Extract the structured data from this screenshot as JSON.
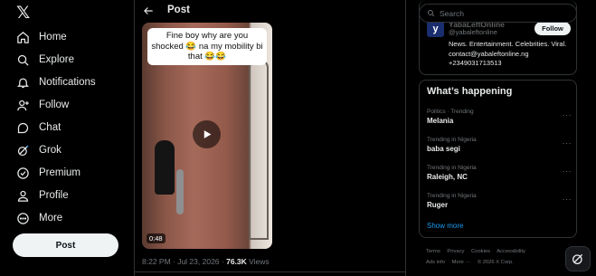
{
  "nav": {
    "logo": "𝕏",
    "items": [
      {
        "label": "Home",
        "icon": "home-icon"
      },
      {
        "label": "Explore",
        "icon": "search-icon"
      },
      {
        "label": "Notifications",
        "icon": "bell-icon"
      },
      {
        "label": "Follow",
        "icon": "add-user-icon"
      },
      {
        "label": "Chat",
        "icon": "chat-icon"
      },
      {
        "label": "Grok",
        "icon": "grok-icon"
      },
      {
        "label": "Premium",
        "icon": "premium-icon"
      },
      {
        "label": "Profile",
        "icon": "profile-icon"
      },
      {
        "label": "More",
        "icon": "more-circle-icon"
      }
    ],
    "post_button": "Post"
  },
  "post": {
    "header_title": "Post",
    "caption": "Fine boy why are you shocked 😂 na my mobility bi that 😂😂",
    "duration": "0:48",
    "time": "8:22 PM · Jul 23, 2026 ·",
    "views_count": "76.3K",
    "views_label": "Views"
  },
  "search": {
    "placeholder": "Search"
  },
  "account": {
    "avatar_letter": "y",
    "name": "YabaLeftOnline",
    "handle": "@yabaleftonline",
    "follow_label": "Follow",
    "bio": "News. Entertainment. Celebrities. Viral. contact@yabaleftonline.ng +2349031713513"
  },
  "happening": {
    "title": "What’s happening",
    "trends": [
      {
        "context": "Politics · Trending",
        "name": "Melania"
      },
      {
        "context": "Trending in Nigeria",
        "name": "baba segi"
      },
      {
        "context": "Trending in Nigeria",
        "name": "Raleigh, NC"
      },
      {
        "context": "Trending in Nigeria",
        "name": "Ruger"
      }
    ],
    "show_more": "Show more"
  },
  "footer": {
    "links": [
      "Terms",
      "Privacy",
      "Cookies",
      "Accessibility",
      "Ads info",
      "More ···",
      "© 2026 X Corp."
    ]
  },
  "colors": {
    "accent": "#1d9bf0",
    "background": "#000000",
    "border": "#2f3336"
  }
}
